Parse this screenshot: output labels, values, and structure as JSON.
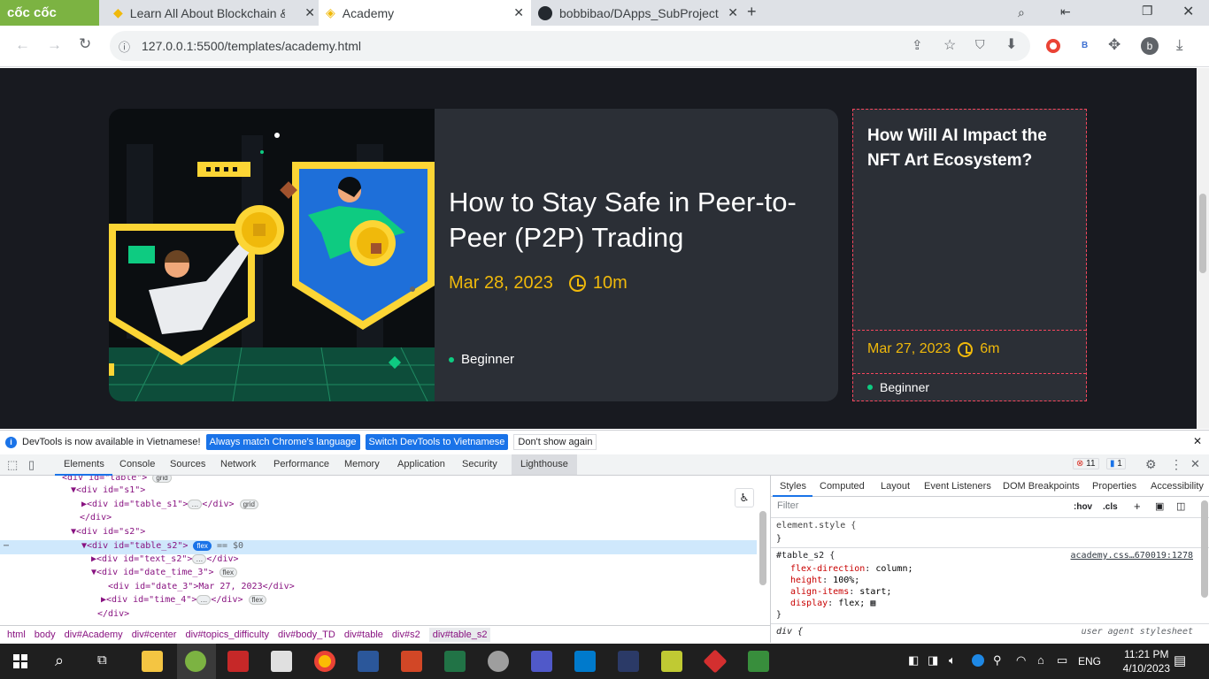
{
  "browser": {
    "brand": "cốc cốc",
    "tabs": [
      {
        "title": "Learn All About Blockchain & ..."
      },
      {
        "title": "Academy"
      },
      {
        "title": "bobbibao/DApps_SubProject"
      }
    ],
    "url": "127.0.0.1:5500/templates/academy.html",
    "profile_letter": "b",
    "ext_letter": "B"
  },
  "page": {
    "featured": {
      "title": "How to Stay Safe in Peer-to-Peer (P2P) Trading",
      "date": "Mar 28, 2023",
      "duration": "10m",
      "difficulty": "Beginner"
    },
    "side": {
      "title": "How Will AI Impact the NFT Art Ecosystem?",
      "date": "Mar 27, 2023",
      "duration": "6m",
      "difficulty": "Beginner"
    }
  },
  "devtools": {
    "info": "DevTools is now available in Vietnamese!",
    "btn_match": "Always match Chrome's language",
    "btn_switch": "Switch DevTools to Vietnamese",
    "btn_dont": "Don't show again",
    "tabs": [
      "Elements",
      "Console",
      "Sources",
      "Network",
      "Performance",
      "Memory",
      "Application",
      "Security",
      "Lighthouse"
    ],
    "errors": "11",
    "messages": "1",
    "style_tabs": [
      "Styles",
      "Computed",
      "Layout",
      "Event Listeners",
      "DOM Breakpoints",
      "Properties",
      "Accessibility"
    ],
    "filter_placeholder": "Filter",
    "hov": ":hov",
    "cls": ".cls",
    "breadcrumbs": [
      "html",
      "body",
      "div#Academy",
      "div#center",
      "div#topics_difficulty",
      "div#body_TD",
      "div#table",
      "div#s2",
      "div#table_s2"
    ],
    "dom": {
      "l0": "<div id=\"table\">",
      "l1": "▼<div id=\"s1\">",
      "l2": "▶<div id=\"table_s1\">",
      "l2b": "</div>",
      "l3": "</div>",
      "l4": "▼<div id=\"s2\">",
      "l5": "▼<div id=\"table_s2\">",
      "l5eq": "== $0",
      "l6": "▶<div id=\"text_s2\">",
      "l6b": "</div>",
      "l7": "▼<div id=\"date_time_3\">",
      "l8": "<div id=\"date_3\">Mar 27, 2023</div>",
      "l9": "▶<div id=\"time_4\">",
      "l9b": "</div>",
      "l10": "</div>",
      "badge_grid": "grid",
      "badge_flex": "flex",
      "ellipsis": "…"
    },
    "css": {
      "elem": "element.style {",
      "close": "}",
      "sel": "#table_s2 {",
      "source": "academy.css…670019:1278",
      "p1": "flex-direction",
      "v1": "column;",
      "p2": "height",
      "v2": "100%;",
      "p3": "align-items",
      "v3": "start;",
      "p4": "display",
      "v4": "flex;",
      "ua_sel": "div {",
      "ua": "user agent stylesheet"
    }
  },
  "taskbar": {
    "lang": "ENG",
    "time": "11:21 PM",
    "date": "4/10/2023"
  }
}
